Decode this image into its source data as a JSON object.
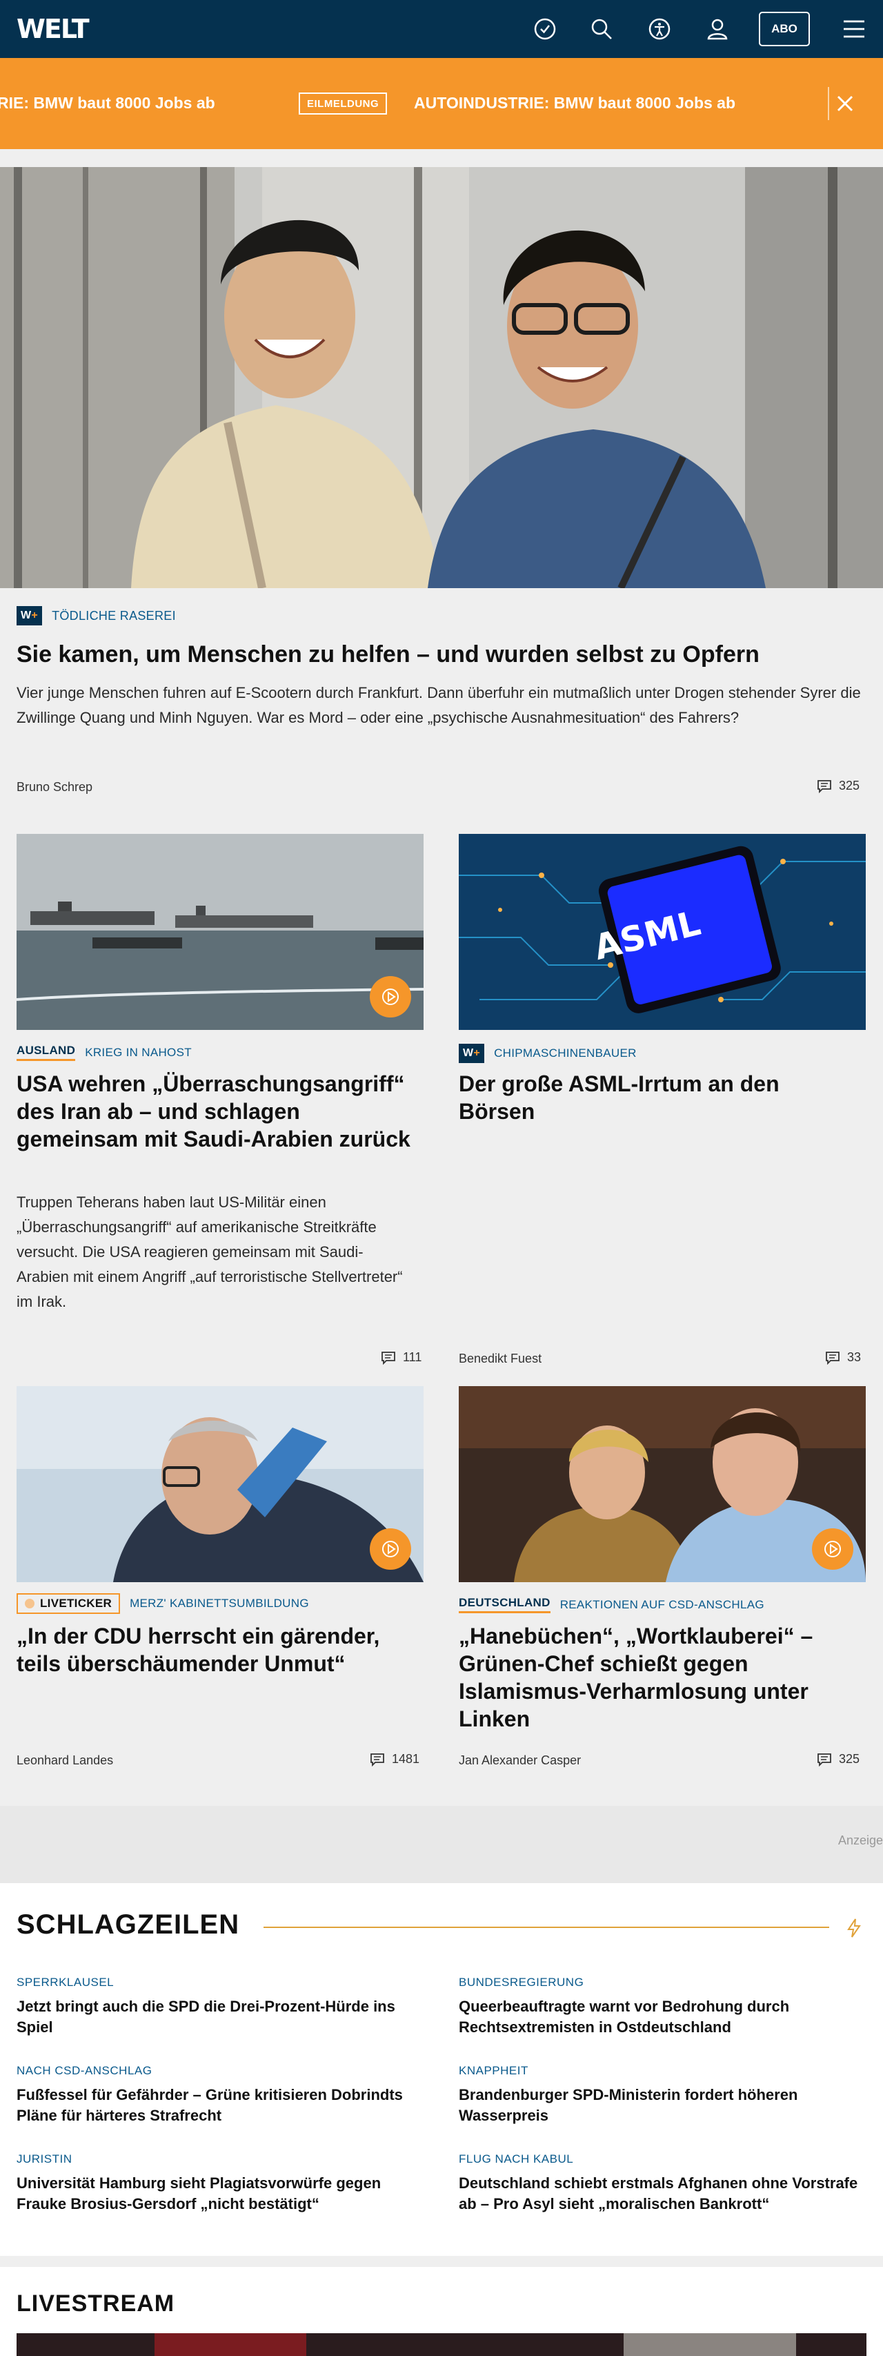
{
  "header": {
    "logo": "WELT",
    "abo_label": "ABO"
  },
  "ticker": {
    "text_partial": "RIE: BMW baut 8000 Jobs ab",
    "badge": "EILMELDUNG",
    "text": "AUTOINDUSTRIE: BMW baut 8000 Jobs ab"
  },
  "hero": {
    "plus_badge": "W+",
    "kicker": "TÖDLICHE RASEREI",
    "headline": "Sie kamen, um Menschen zu helfen – und wurden selbst zu Opfern",
    "teaser": "Vier junge Menschen fuhren auf E-Scootern durch Frankfurt. Dann überfuhr ein mutmaßlich unter Drogen stehender Syrer die Zwillinge Quang und Minh Nguyen. War es Mord – oder eine „psychische Ausnahmesituation“ des Fahrers?",
    "author": "Bruno Schrep",
    "comments": "325"
  },
  "articles": [
    {
      "rubrik": "AUSLAND",
      "kicker": "KRIEG IN NAHOST",
      "headline": "USA wehren „Überraschungsangriff“ des Iran ab – und schlagen gemeinsam mit Saudi-Arabien zurück",
      "teaser": "Truppen Teherans haben laut US-Militär einen „Überraschungsangriff“ auf amerikanische Streitkräfte versucht. Die USA reagieren gemeinsam mit Saudi-Arabien mit einem Angriff „auf terroristische Stellvertreter“ im Irak.",
      "author": "",
      "comments": "111"
    },
    {
      "plus_badge": "W+",
      "kicker": "CHIPMASCHINENBAUER",
      "headline": "Der große ASML-Irrtum an den Börsen",
      "image_text": "ASML",
      "author": "Benedikt Fuest",
      "comments": "33"
    },
    {
      "live_badge": "LIVETICKER",
      "kicker": "MERZ' KABINETTSUMBILDUNG",
      "headline": "„In der CDU herrscht ein gärender, teils überschäumender Unmut“",
      "author": "Leonhard Landes",
      "comments": "1481"
    },
    {
      "rubrik": "DEUTSCHLAND",
      "kicker": "REAKTIONEN AUF CSD-ANSCHLAG",
      "headline": "„Hanebüchen“, „Wortklauberei“ – Grünen-Chef schießt gegen Islamismus-Verharmlosung unter Linken",
      "author": "Jan Alexander Casper",
      "comments": "325"
    }
  ],
  "ad": {
    "label": "Anzeige"
  },
  "schlagzeilen": {
    "title": "SCHLAGZEILEN",
    "items": [
      {
        "kicker": "SPERRKLAUSEL",
        "headline": "Jetzt bringt auch die SPD die Drei-Prozent-Hürde ins Spiel"
      },
      {
        "kicker": "BUNDESREGIERUNG",
        "headline": "Queerbeauftragte warnt vor Bedrohung durch Rechtsextremisten in Ostdeutschland"
      },
      {
        "kicker": "NACH CSD-ANSCHLAG",
        "headline": "Fußfessel für Gefährder – Grüne kritisieren Dobrindts Pläne für härteres Strafrecht"
      },
      {
        "kicker": "KNAPPHEIT",
        "headline": "Brandenburger SPD-Ministerin fordert höheren Wasserpreis"
      },
      {
        "kicker": "JURISTIN",
        "headline": "Universität Hamburg sieht Plagiatsvorwürfe gegen Frauke Brosius-Gersdorf „nicht bestätigt“"
      },
      {
        "kicker": "FLUG NACH KABUL",
        "headline": "Deutschland schiebt erstmals Afghanen ohne Vorstrafe ab – Pro Asyl sieht „moralischen Bankrott“"
      }
    ]
  },
  "livestream": {
    "title": "LIVESTREAM"
  },
  "colors": {
    "navy": "#05314f",
    "orange": "#f5962a",
    "link_blue": "#0a5a8c"
  }
}
